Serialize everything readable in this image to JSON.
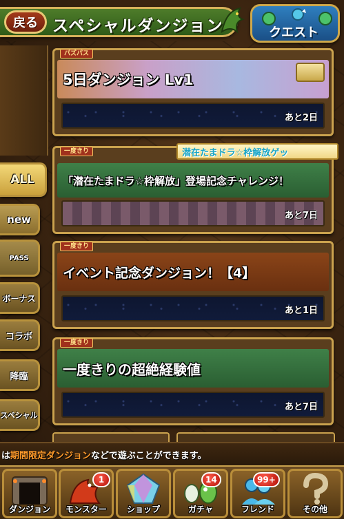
{
  "header": {
    "back_label": "戻る",
    "title": "スペシャルダンジョン",
    "quest_label": "クエスト"
  },
  "tabs": [
    {
      "label": "ALL"
    },
    {
      "label": "new"
    },
    {
      "label": "PASS"
    },
    {
      "label": "ボーナス"
    },
    {
      "label": "コラボ"
    },
    {
      "label": "降臨"
    },
    {
      "label": "スペシャル"
    }
  ],
  "dungeons": [
    {
      "tag": "パズパス",
      "title": "5日ダンジョン Lv1",
      "remaining": "あと2日",
      "color": "#b99ac8"
    },
    {
      "tag": "一度きり",
      "title": "「潜在たまドラ☆枠解放」登場記念チャレンジ！",
      "remaining": "あと7日",
      "color": "#2f6b3a"
    },
    {
      "tag": "一度きり",
      "title": "イベント記念ダンジョン！【4】",
      "remaining": "あと1日",
      "color": "#7a3a14"
    },
    {
      "tag": "一度きり",
      "title": "一度きりの超絶経験値",
      "remaining": "あと7日",
      "color": "#2f6b3a"
    }
  ],
  "promo_ribbon": "潜在たまドラ☆枠解放ゲッ",
  "info_text": {
    "prefix": "は",
    "highlight1": "期間限定ダンジョン",
    "suffix": "などで遊ぶことができます。"
  },
  "bottom_nav": [
    {
      "label": "ダンジョン",
      "badge": ""
    },
    {
      "label": "モンスター",
      "badge": "1"
    },
    {
      "label": "ショップ",
      "badge": ""
    },
    {
      "label": "ガチャ",
      "badge": "14"
    },
    {
      "label": "フレンド",
      "badge": "99+"
    },
    {
      "label": "その他",
      "badge": ""
    }
  ]
}
